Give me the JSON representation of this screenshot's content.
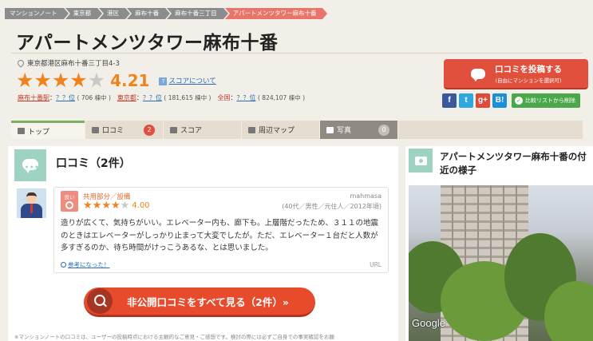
{
  "breadcrumb": [
    "マンションノート",
    "東京都",
    "港区",
    "麻布十番",
    "麻布十番三丁目",
    "アパートメンツタワー麻布十番"
  ],
  "title": "アパートメンツタワー麻布十番",
  "address": "東京都港区麻布十番三丁目4-3",
  "rating": {
    "score": "4.21",
    "stars_on": 4,
    "stars_total": 5,
    "score_link": "スコアについて"
  },
  "ranks": [
    {
      "label": "麻布十番駅",
      "rank": "？？位",
      "count": "( 706 棟中 )"
    },
    {
      "label": "東京都",
      "rank": "？？位",
      "count": "( 181,615 棟中 )"
    },
    {
      "label": "全国",
      "rank": "？？位",
      "count": "( 824,107 棟中 )"
    }
  ],
  "post_button": {
    "main": "口コミを投稿する",
    "sub": "(自由にマンションを選択可)"
  },
  "share": {
    "facebook": "f",
    "twitter": "t",
    "gplus": "g+",
    "hatena": "B!",
    "compare": "比較リストから削除"
  },
  "tabs": [
    {
      "label": "トップ",
      "active": true
    },
    {
      "label": "口コミ",
      "badge": "2"
    },
    {
      "label": "スコア"
    },
    {
      "label": "周辺マップ"
    },
    {
      "label": "写真",
      "badge": "0"
    }
  ],
  "reviews": {
    "heading": "口コミ（2件）",
    "item": {
      "badge": "良い",
      "category": "共用部分／設備",
      "stars_on": 4,
      "value": "4.00",
      "author": "mahmasa",
      "meta": "(40代／男性／元住人／2012年頃)",
      "text": "造りが広くて、気持ちがいい。エレベーター内も、廊下も。上層階だったため、３１１の地震のときはエレベーターがしっかり止まって大変でしたが。ただ、エレベーター１台だと人数が多すぎるのか、待ち時間がけっこうあるな、とは思いました。",
      "helpful": "参考になった！",
      "url_label": "URL"
    },
    "see_all": "非公開口コミをすべて見る（2件）»",
    "disclaimer": "※マンションノートの口コミは、ユーザーの投稿時点における主観的なご意見・ご感想です。検討の際には必ずご自身での事実確認をお願"
  },
  "side": {
    "title": "アパートメンツタワー麻布十番の付近の様子",
    "streetview_logo": "Google"
  },
  "colors": {
    "accent": "#f0831e",
    "primary_button": "#e0503c",
    "see_all_button": "#e84a2c",
    "teal_icon": "#9ed3c3",
    "compare": "#4aa84a"
  }
}
